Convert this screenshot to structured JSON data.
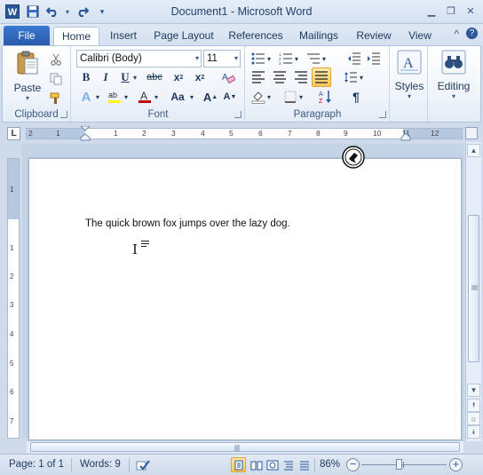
{
  "window": {
    "app_icon": "W",
    "title": "Document1 - Microsoft Word",
    "controls": [
      "minimize-icon",
      "restore-icon",
      "close-icon"
    ]
  },
  "quick_access": [
    "save-icon",
    "undo-icon",
    "redo-icon",
    "customize-qat-icon"
  ],
  "tabs": {
    "file": "File",
    "items": [
      "Home",
      "Insert",
      "Page Layout",
      "References",
      "Mailings",
      "Review",
      "View"
    ],
    "active": "Home"
  },
  "ribbon": {
    "clipboard": {
      "label": "Clipboard",
      "paste": "Paste"
    },
    "font": {
      "label": "Font",
      "font_name": "Calibri (Body)",
      "font_size": "11"
    },
    "paragraph": {
      "label": "Paragraph"
    },
    "styles": {
      "label": "Styles"
    },
    "editing": {
      "label": "Editing"
    }
  },
  "ruler": {
    "tab_selector": "L",
    "h_numbers": [
      "2",
      "1",
      "1",
      "2",
      "3",
      "4",
      "5",
      "6",
      "7",
      "8",
      "9",
      "10",
      "11",
      "12"
    ],
    "v_numbers": [
      "1",
      "1",
      "2",
      "3",
      "4",
      "5",
      "6",
      "7"
    ]
  },
  "document": {
    "text": "The quick brown fox jumps over the lazy dog."
  },
  "status": {
    "page": "Page: 1 of 1",
    "words": "Words: 9",
    "zoom": "86%",
    "zoom_minus": "−",
    "zoom_plus": "+"
  },
  "colors": {
    "accent": "#2b579a",
    "file_tab": "#2d64b8",
    "highlight": "#f7c85a"
  }
}
